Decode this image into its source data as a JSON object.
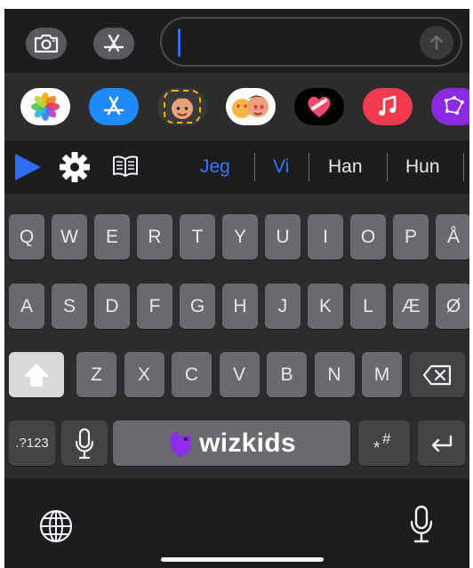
{
  "message_bar": {
    "camera_icon": "camera-icon",
    "appstore_icon": "app-store-icon",
    "send_icon": "arrow-up-icon",
    "caret_color": "#2f6df6"
  },
  "app_strip": {
    "apps": [
      "photos-app-icon",
      "app-store-app-icon",
      "memoji-app-icon",
      "memoji-stickers-app-icon",
      "digital-touch-app-icon",
      "music-app-icon",
      "constellation-app-icon"
    ]
  },
  "toolbar": {
    "play_icon": "play-icon",
    "settings_icon": "gear-icon",
    "book_icon": "book-icon",
    "suggestions": [
      {
        "text": "Jeg",
        "color": "#3478f6"
      },
      {
        "text": "Vi",
        "color": "#3478f6"
      },
      {
        "text": "Han",
        "color": "#e8e8ea"
      },
      {
        "text": "Hun",
        "color": "#e8e8ea"
      }
    ]
  },
  "keyboard": {
    "row1": [
      "Q",
      "W",
      "E",
      "R",
      "T",
      "Y",
      "U",
      "I",
      "O",
      "P",
      "Å"
    ],
    "row2": [
      "A",
      "S",
      "D",
      "F",
      "G",
      "H",
      "J",
      "K",
      "L",
      "Æ",
      "Ø"
    ],
    "row3": [
      "Z",
      "X",
      "C",
      "V",
      "B",
      "N",
      "M"
    ],
    "numbers_key": ".?123",
    "space_brand": "wizkids",
    "hash_key": "#",
    "brand_color": "#8e2cf0"
  },
  "bottom": {
    "globe_icon": "globe-icon",
    "dictation_icon": "microphone-icon"
  }
}
